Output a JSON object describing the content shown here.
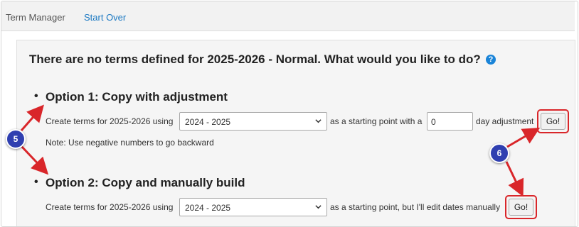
{
  "topbar": {
    "term_manager": "Term Manager",
    "start_over": "Start Over"
  },
  "main": {
    "heading": "There are no terms defined for 2025-2026 - Normal. What would you like to do?",
    "help_glyph": "?"
  },
  "option1": {
    "bullet": "•",
    "title": "Option 1: Copy with adjustment",
    "create_text": "Create terms for 2025-2026 using",
    "select_value": "2024 - 2025",
    "mid_text": "as a starting point with a",
    "adjustment_value": "0",
    "day_text": "day adjustment",
    "go_label": "Go!",
    "note": "Note: Use negative numbers to go backward"
  },
  "option2": {
    "bullet": "•",
    "title": "Option 2: Copy and manually build",
    "create_text": "Create terms for 2025-2026 using",
    "select_value": "2024 - 2025",
    "mid_text": "as a starting point, but I'll edit dates manually",
    "go_label": "Go!"
  },
  "callouts": {
    "badge_5": "5",
    "badge_6": "6"
  },
  "colors": {
    "link": "#1a78c2",
    "help": "#1a84d8",
    "callout_arrow": "#d9262a",
    "badge": "#2f3fb0"
  },
  "icons": {
    "help": "help-circle-icon",
    "dropdown": "chevron-down-icon"
  }
}
